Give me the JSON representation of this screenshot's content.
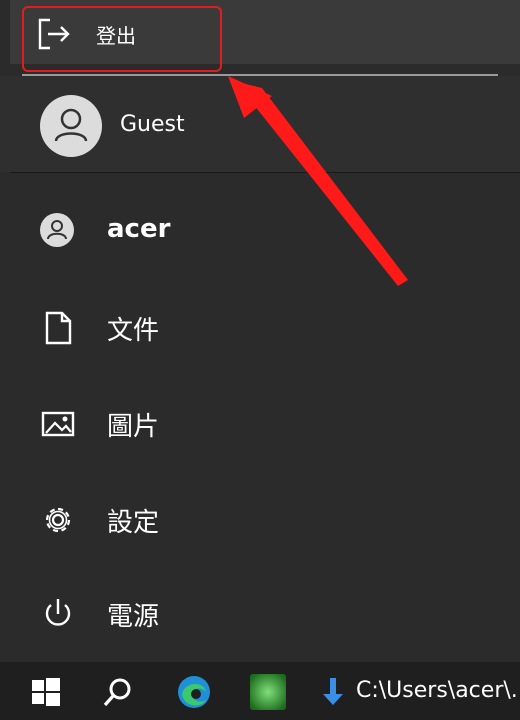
{
  "sign_out": {
    "label": "登出"
  },
  "account": {
    "guest_name": "Guest"
  },
  "menu": {
    "user": "acer",
    "documents": "文件",
    "pictures": "圖片",
    "settings": "設定",
    "power": "電源"
  },
  "taskbar": {
    "path_text": "C:\\Users\\acer\\."
  },
  "colors": {
    "highlight": "#e01e1e",
    "background": "#2b2b2b",
    "taskbar": "#1f1f1f"
  },
  "icons": [
    "sign-out-icon",
    "user-avatar-icon",
    "document-icon",
    "image-icon",
    "gear-icon",
    "power-icon",
    "windows-start-icon",
    "search-icon",
    "edge-icon",
    "green-app-icon",
    "download-arrow-icon"
  ]
}
